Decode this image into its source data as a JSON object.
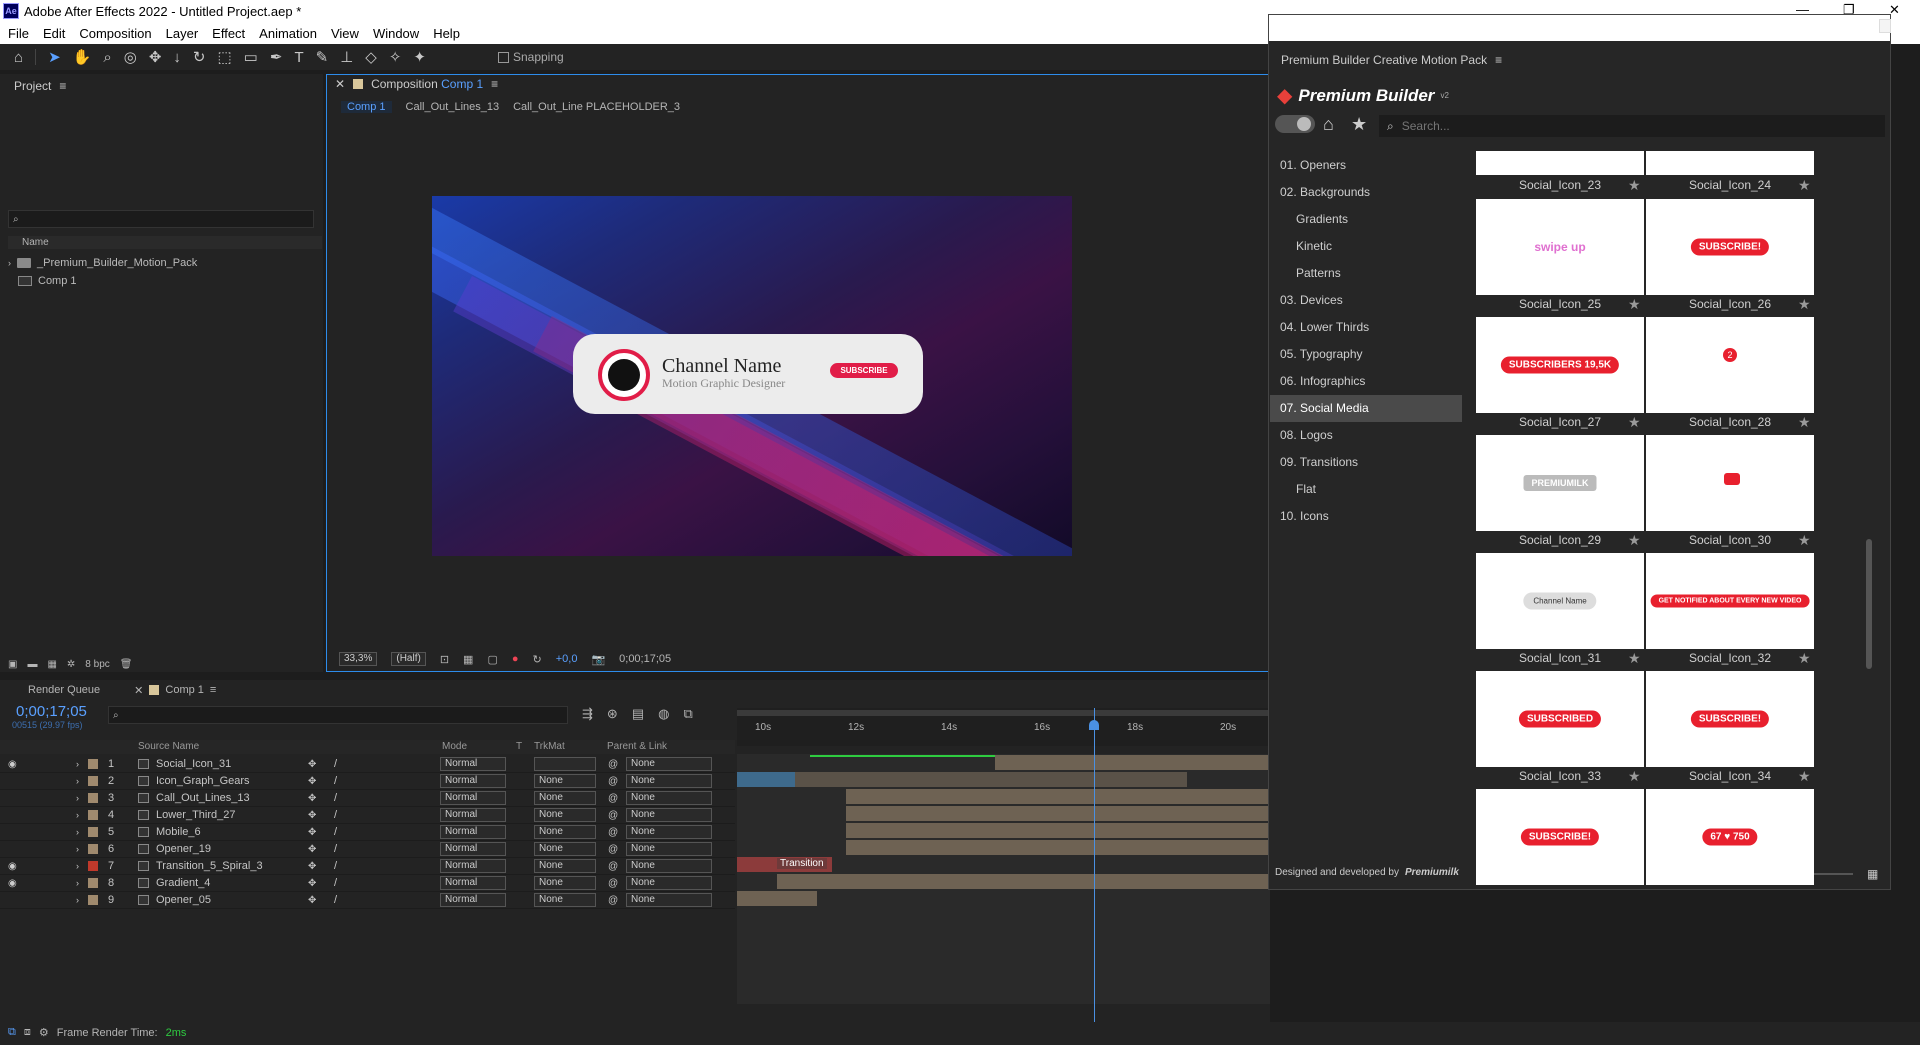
{
  "app": {
    "title": "Adobe After Effects 2022 - Untitled Project.aep *",
    "logo": "Ae"
  },
  "menu": [
    "File",
    "Edit",
    "Composition",
    "Layer",
    "Effect",
    "Animation",
    "View",
    "Window",
    "Help"
  ],
  "toolbar": {
    "snapping": "Snapping"
  },
  "project": {
    "title": "Project",
    "col_name": "Name",
    "items": [
      {
        "name": "_Premium_Builder_Motion_Pack",
        "type": "folder"
      },
      {
        "name": "Comp 1",
        "type": "comp"
      }
    ],
    "bpc": "8 bpc"
  },
  "composition": {
    "panel_prefix": "Composition",
    "panel_name": "Comp 1",
    "breadcrumbs": [
      "Comp 1",
      "Call_Out_Lines_13",
      "Call_Out_Line PLACEHOLDER_3"
    ],
    "zoom": "33,3%",
    "resolution": "(Half)",
    "exposure": "+0,0",
    "timecode": "0;00;17;05"
  },
  "card": {
    "channel_name": "Channel Name",
    "subtitle": "Motion Graphic Designer",
    "button": "SUBSCRIBE"
  },
  "timeline": {
    "tabs": [
      "Render Queue",
      "Comp 1"
    ],
    "timecode": "0;00;17;05",
    "fps": "00515 (29.97 fps)",
    "col_source": "Source Name",
    "col_mode": "Mode",
    "col_t": "T",
    "col_trkmat": "TrkMat",
    "col_parent": "Parent & Link",
    "ruler": [
      "10s",
      "12s",
      "14s",
      "16s",
      "18s",
      "20s"
    ],
    "transition_label": "Transition",
    "layers": [
      {
        "num": "1",
        "name": "Social_Icon_31",
        "mode": "Normal",
        "trkmat": "",
        "parent": "None",
        "eye": "true",
        "color": "#a08a6e"
      },
      {
        "num": "2",
        "name": "Icon_Graph_Gears",
        "mode": "Normal",
        "trkmat": "None",
        "parent": "None",
        "eye": "false",
        "color": "#a08a6e"
      },
      {
        "num": "3",
        "name": "Call_Out_Lines_13",
        "mode": "Normal",
        "trkmat": "None",
        "parent": "None",
        "eye": "false",
        "color": "#a08a6e"
      },
      {
        "num": "4",
        "name": "Lower_Third_27",
        "mode": "Normal",
        "trkmat": "None",
        "parent": "None",
        "eye": "false",
        "color": "#a08a6e"
      },
      {
        "num": "5",
        "name": "Mobile_6",
        "mode": "Normal",
        "trkmat": "None",
        "parent": "None",
        "eye": "false",
        "color": "#a08a6e"
      },
      {
        "num": "6",
        "name": "Opener_19",
        "mode": "Normal",
        "trkmat": "None",
        "parent": "None",
        "eye": "false",
        "color": "#a08a6e"
      },
      {
        "num": "7",
        "name": "Transition_5_Spiral_3",
        "mode": "Normal",
        "trkmat": "None",
        "parent": "None",
        "eye": "true",
        "color": "#c0392b"
      },
      {
        "num": "8",
        "name": "Gradient_4",
        "mode": "Normal",
        "trkmat": "None",
        "parent": "None",
        "eye": "true",
        "color": "#a08a6e"
      },
      {
        "num": "9",
        "name": "Opener_05",
        "mode": "Normal",
        "trkmat": "None",
        "parent": "None",
        "eye": "false",
        "color": "#a08a6e"
      }
    ]
  },
  "plugin": {
    "window_title": "Premium Builder Creative Motion Pack",
    "brand": "Premium Builder",
    "brand_sup": "v2",
    "search_placeholder": "Search...",
    "footer": "Designed and developed by",
    "footer_brand": "Premiumilk",
    "categories": [
      {
        "label": "01. Openers",
        "sub": false,
        "active": false
      },
      {
        "label": "02. Backgrounds",
        "sub": false,
        "active": false
      },
      {
        "label": "Gradients",
        "sub": true,
        "active": false
      },
      {
        "label": "Kinetic",
        "sub": true,
        "active": false
      },
      {
        "label": "Patterns",
        "sub": true,
        "active": false
      },
      {
        "label": "03. Devices",
        "sub": false,
        "active": false
      },
      {
        "label": "04. Lower Thirds",
        "sub": false,
        "active": false
      },
      {
        "label": "05. Typography",
        "sub": false,
        "active": false
      },
      {
        "label": "06. Infographics",
        "sub": false,
        "active": false
      },
      {
        "label": "07. Social Media",
        "sub": false,
        "active": true
      },
      {
        "label": "08. Logos",
        "sub": false,
        "active": false
      },
      {
        "label": "09. Transitions",
        "sub": false,
        "active": false
      },
      {
        "label": "Flat",
        "sub": true,
        "active": false
      },
      {
        "label": "10. Icons",
        "sub": false,
        "active": false
      }
    ],
    "thumbs": [
      {
        "label": "Social_Icon_23",
        "preview": ""
      },
      {
        "label": "Social_Icon_24",
        "preview": ""
      },
      {
        "label": "Social_Icon_25",
        "preview": "swipe up"
      },
      {
        "label": "Social_Icon_26",
        "preview": "SUBSCRIBE!"
      },
      {
        "label": "Social_Icon_27",
        "preview": "SUBSCRIBERS 19,5K"
      },
      {
        "label": "Social_Icon_28",
        "preview": "2"
      },
      {
        "label": "Social_Icon_29",
        "preview": "PREMIUMILK"
      },
      {
        "label": "Social_Icon_30",
        "preview": ""
      },
      {
        "label": "Social_Icon_31",
        "preview": "Channel Name"
      },
      {
        "label": "Social_Icon_32",
        "preview": "GET NOTIFIED ABOUT EVERY NEW VIDEO"
      },
      {
        "label": "Social_Icon_33",
        "preview": "SUBSCRIBED"
      },
      {
        "label": "Social_Icon_34",
        "preview": "SUBSCRIBE!"
      },
      {
        "label": "",
        "preview": "SUBSCRIBE!"
      },
      {
        "label": "",
        "preview": "67 ♥ 750"
      }
    ]
  },
  "status": {
    "label": "Frame Render Time:",
    "value": "2ms"
  }
}
